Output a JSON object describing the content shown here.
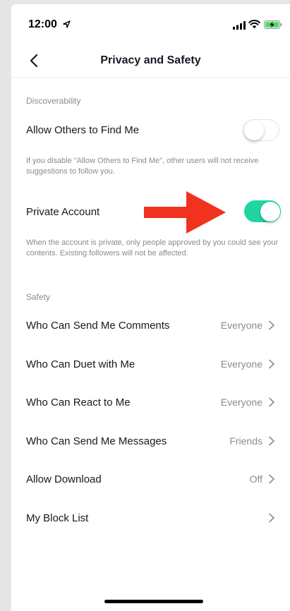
{
  "status_bar": {
    "time": "12:00",
    "icons": [
      "location-icon",
      "signal-icon",
      "wifi-icon",
      "battery-charging-icon"
    ]
  },
  "header": {
    "title": "Privacy and Safety",
    "back_icon": "chevron-left-icon"
  },
  "discoverability": {
    "header": "Discoverability",
    "allow_find": {
      "label": "Allow Others to Find Me",
      "enabled": false,
      "description": "If you disable \"Allow Others to Find Me\", other users will not receive suggestions to follow you."
    },
    "private_account": {
      "label": "Private Account",
      "enabled": true,
      "description": "When the account is private, only people approved by you could see your contents. Existing followers will not be affected."
    }
  },
  "safety": {
    "header": "Safety",
    "items": [
      {
        "label": "Who Can Send Me Comments",
        "value": "Everyone"
      },
      {
        "label": "Who Can Duet with Me",
        "value": "Everyone"
      },
      {
        "label": "Who Can React to Me",
        "value": "Everyone"
      },
      {
        "label": "Who Can Send Me Messages",
        "value": "Friends"
      },
      {
        "label": "Allow Download",
        "value": "Off"
      },
      {
        "label": "My Block List",
        "value": ""
      }
    ]
  },
  "colors": {
    "toggle_on": "#20d5a0",
    "annotation_arrow": "#f0321e",
    "secondary_text": "#8a8b91"
  }
}
